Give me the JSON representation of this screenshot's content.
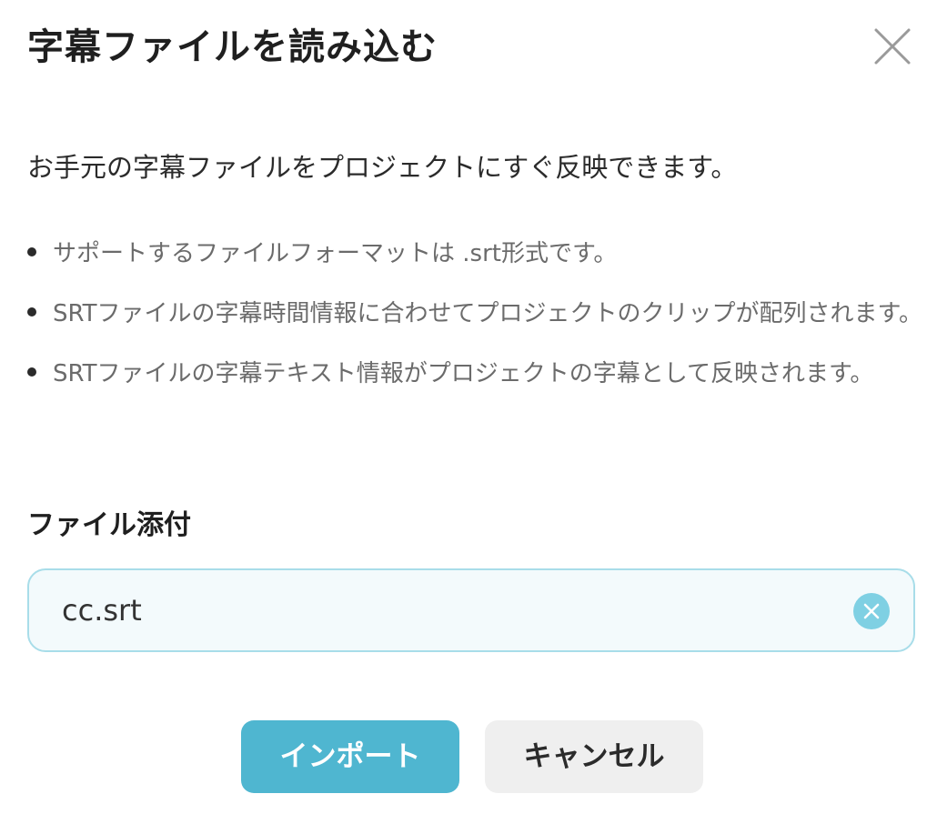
{
  "dialog": {
    "title": "字幕ファイルを読み込む",
    "close_icon": "close-icon",
    "intro": "お手元の字幕ファイルをプロジェクトにすぐ反映できます。",
    "notes": [
      "サポートするファイルフォーマットは .srt形式です。",
      "SRTファイルの字幕時間情報に合わせてプロジェクトのクリップが配列されます。",
      "SRTファイルの字幕テキスト情報がプロジェクトの字幕として反映されます。"
    ],
    "attachment": {
      "label": "ファイル添付",
      "file_name": "cc.srt",
      "clear_icon": "clear-icon"
    },
    "buttons": {
      "import": "インポート",
      "cancel": "キャンセル"
    }
  },
  "colors": {
    "accent": "#4fb6d0",
    "file_box_border": "#a8dde9",
    "file_box_bg": "#f3fafc",
    "clear_icon_bg": "#7fd0e3",
    "cancel_bg": "#efefef"
  }
}
